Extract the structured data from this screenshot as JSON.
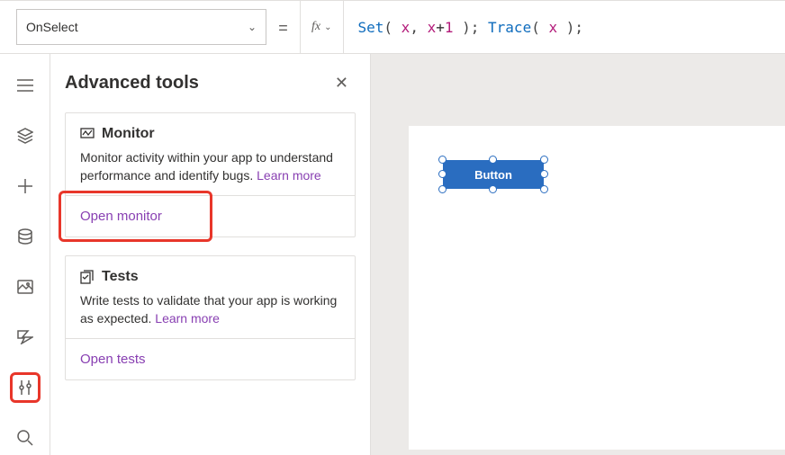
{
  "property_selector": {
    "value": "OnSelect"
  },
  "fx_label": "fx",
  "formula": {
    "tokens": [
      {
        "cls": "tok-fn",
        "t": "Set"
      },
      {
        "cls": "tok-pn",
        "t": "( "
      },
      {
        "cls": "tok-var",
        "t": "x"
      },
      {
        "cls": "tok-pn",
        "t": ", "
      },
      {
        "cls": "tok-var",
        "t": "x"
      },
      {
        "cls": "tok-op",
        "t": "+"
      },
      {
        "cls": "tok-var",
        "t": "1"
      },
      {
        "cls": "tok-pn",
        "t": " ); "
      },
      {
        "cls": "tok-fn",
        "t": "Trace"
      },
      {
        "cls": "tok-pn",
        "t": "( "
      },
      {
        "cls": "tok-var",
        "t": "x"
      },
      {
        "cls": "tok-pn",
        "t": " );"
      }
    ]
  },
  "panel": {
    "title": "Advanced tools",
    "monitor": {
      "title": "Monitor",
      "desc": "Monitor activity within your app to understand performance and identify bugs. ",
      "learn_more": "Learn more",
      "action": "Open monitor"
    },
    "tests": {
      "title": "Tests",
      "desc": "Write tests to validate that your app is working as expected. ",
      "learn_more": "Learn more",
      "action": "Open tests"
    }
  },
  "canvas": {
    "button_label": "Button"
  }
}
